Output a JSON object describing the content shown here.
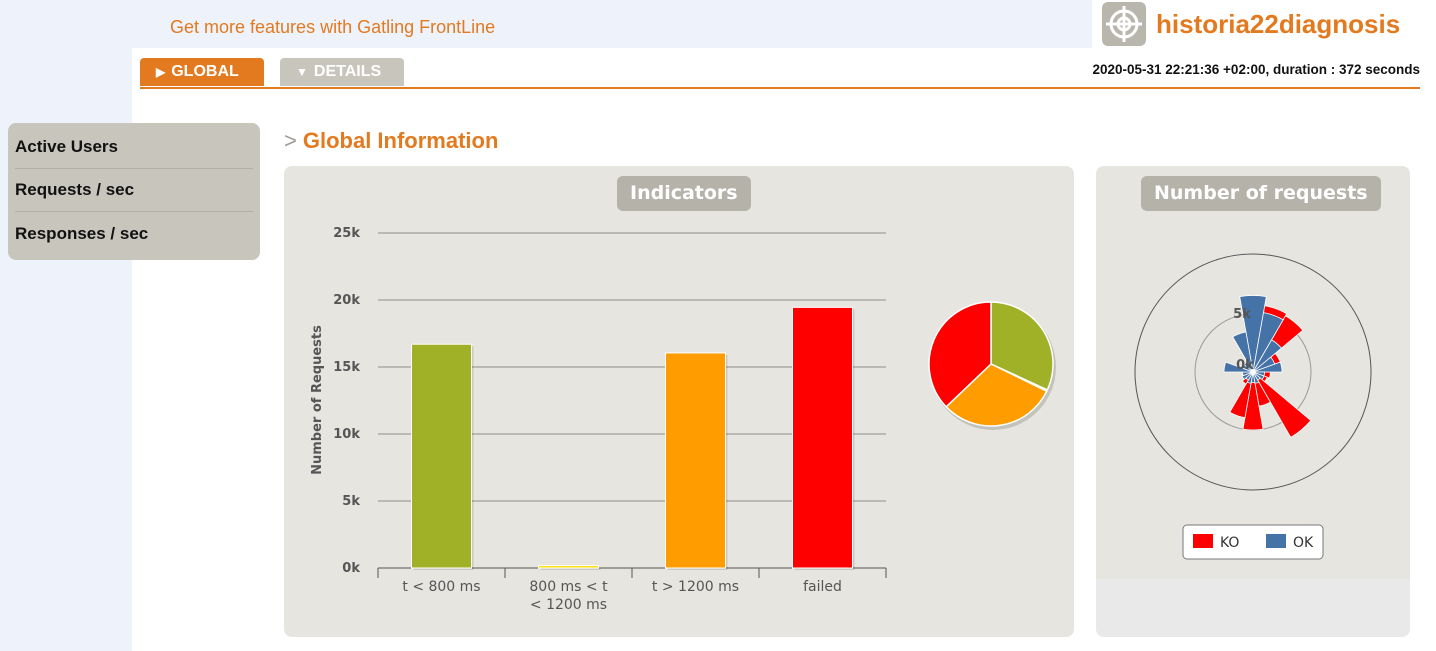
{
  "promo": {
    "text": "Get more features with Gatling FrontLine"
  },
  "brand": {
    "name": "historia22diagnosis",
    "icon": "target-icon"
  },
  "tabs": [
    {
      "label": "GLOBAL",
      "active": true,
      "icon": "triangle-right-icon"
    },
    {
      "label": "DETAILS",
      "active": false,
      "icon": "triangle-down-icon"
    }
  ],
  "run_info": "2020-05-31 22:21:36 +02:00, duration : 372 seconds",
  "sidebar": {
    "items": [
      {
        "label": "Active Users"
      },
      {
        "label": "Requests / sec"
      },
      {
        "label": "Responses / sec"
      }
    ]
  },
  "section": {
    "prefix": ">",
    "title": "Global Information"
  },
  "indicators": {
    "title": "Indicators"
  },
  "requests_panel": {
    "title": "Number of requests"
  },
  "colors": {
    "orange": "#e37a1f",
    "green": "#a0b128",
    "yellow": "#ffdd00",
    "amber": "#ff9d00",
    "red": "#ff0000",
    "ok_blue": "#4572a7"
  },
  "chart_data": [
    {
      "type": "bar",
      "title": "Indicators",
      "ylabel": "Number of Requests",
      "categories": [
        "t < 800 ms",
        "800 ms < t < 1200 ms",
        "t > 1200 ms",
        "failed"
      ],
      "values": [
        16700,
        180,
        16050,
        19450
      ],
      "colors": [
        "#a0b128",
        "#ffdd00",
        "#ff9d00",
        "#ff0000"
      ],
      "ylim": [
        0,
        25000
      ],
      "yticks": [
        0,
        5000,
        10000,
        15000,
        20000,
        25000
      ],
      "ytick_labels": [
        "0k",
        "5k",
        "10k",
        "15k",
        "20k",
        "25k"
      ],
      "grid": true
    },
    {
      "type": "pie",
      "labels": [
        "t < 800 ms",
        "800 ms < t < 1200 ms",
        "t > 1200 ms",
        "failed"
      ],
      "values": [
        16700,
        180,
        16050,
        19450
      ],
      "colors": [
        "#a0b128",
        "#ffdd00",
        "#ff9d00",
        "#ff0000"
      ]
    },
    {
      "type": "polar",
      "title": "Number of requests",
      "radial_tick_labels": [
        "0k",
        "5k"
      ],
      "radial_ticks": [
        0,
        5
      ],
      "legend": [
        {
          "name": "KO",
          "color": "#ff0000"
        },
        {
          "name": "OK",
          "color": "#4572a7"
        }
      ],
      "legend_position": "bottom",
      "series": [
        {
          "name": "OK",
          "values": [
            6.6,
            5.2,
            3.2,
            2.0,
            2.5,
            1.0,
            1.0,
            0.8,
            1.0,
            0.9,
            1.0,
            0.8,
            1.0,
            0.9,
            2.5,
            1.0,
            1.0,
            3.5
          ]
        },
        {
          "name": "KO",
          "values": [
            0,
            5.8,
            5.6,
            2.5,
            1.5,
            1.5,
            1.3,
            6.5,
            3.0,
            5.0,
            4.0,
            1.2,
            1.0,
            0.8,
            0,
            0.8,
            1.0,
            1.5
          ]
        }
      ]
    }
  ]
}
